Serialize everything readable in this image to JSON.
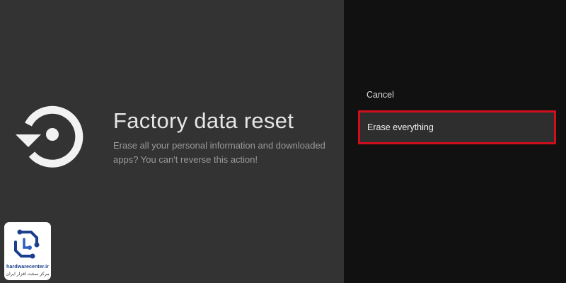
{
  "dialog": {
    "title": "Factory data reset",
    "description": "Erase all your personal information and downloaded apps? You can't reverse this action!",
    "icon": "reset-icon"
  },
  "options": {
    "cancel_label": "Cancel",
    "erase_label": "Erase everything",
    "highlight_color": "#d10f1c"
  },
  "watermark": {
    "name": "hardwarecenter.ir",
    "tagline": "مرکز سخت افزار ایران",
    "brand_color": "#1b3f8c"
  }
}
